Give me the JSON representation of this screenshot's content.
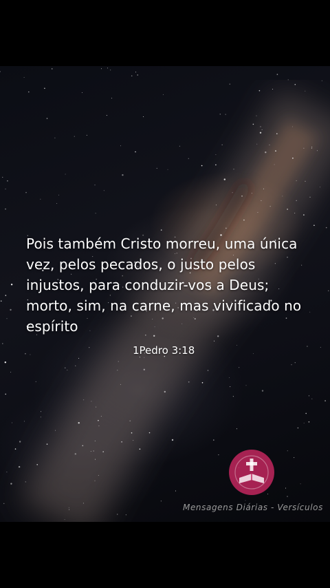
{
  "verse": {
    "text": "Pois também Cristo morreu, uma única vez, pelos pecados, o justo pelos injustos, para conduzir-vos a Deus; morto, sim, na carne, mas vivificado no espírito",
    "reference": "1Pedro 3:18"
  },
  "brand": {
    "logo_icon": "cross-bible-logo-icon",
    "watermark": "Mensagens Diárias - Versículos",
    "accent_color": "#c2275e"
  },
  "colors": {
    "frame": "#000000",
    "text": "#ffffff"
  }
}
